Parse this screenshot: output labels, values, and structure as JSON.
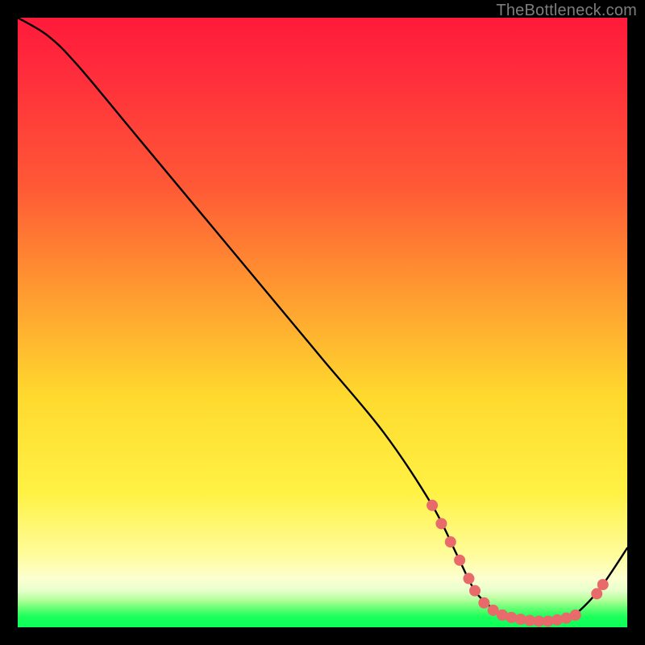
{
  "watermark": "TheBottleneck.com",
  "chart_data": {
    "type": "line",
    "title": "",
    "xlabel": "",
    "ylabel": "",
    "xlim": [
      0,
      100
    ],
    "ylim": [
      0,
      100
    ],
    "grid": false,
    "legend": false,
    "series": [
      {
        "name": "curve",
        "color": "#000000",
        "x": [
          0,
          5,
          10,
          20,
          30,
          40,
          50,
          60,
          68,
          72,
          75,
          78,
          80,
          83,
          86,
          90,
          93,
          96,
          100
        ],
        "y": [
          100,
          97,
          92,
          80,
          68,
          56,
          44,
          32,
          20,
          12,
          6,
          3,
          1.8,
          1.2,
          1.0,
          1.3,
          3.5,
          7,
          13
        ]
      }
    ],
    "markers": [
      {
        "x": 68.0,
        "y": 20.0
      },
      {
        "x": 69.5,
        "y": 17.0
      },
      {
        "x": 71.0,
        "y": 14.0
      },
      {
        "x": 72.5,
        "y": 11.0
      },
      {
        "x": 74.0,
        "y": 8.0
      },
      {
        "x": 75.0,
        "y": 6.0
      },
      {
        "x": 76.5,
        "y": 4.0
      },
      {
        "x": 78.0,
        "y": 2.8
      },
      {
        "x": 79.5,
        "y": 2.0
      },
      {
        "x": 81.0,
        "y": 1.6
      },
      {
        "x": 82.5,
        "y": 1.3
      },
      {
        "x": 84.0,
        "y": 1.1
      },
      {
        "x": 85.5,
        "y": 1.0
      },
      {
        "x": 87.0,
        "y": 1.0
      },
      {
        "x": 88.5,
        "y": 1.2
      },
      {
        "x": 90.0,
        "y": 1.5
      },
      {
        "x": 91.5,
        "y": 2.0
      },
      {
        "x": 95.0,
        "y": 5.5
      },
      {
        "x": 96.0,
        "y": 7.0
      }
    ],
    "marker_style": {
      "color": "#e86a6a",
      "radius_px": 7
    }
  }
}
